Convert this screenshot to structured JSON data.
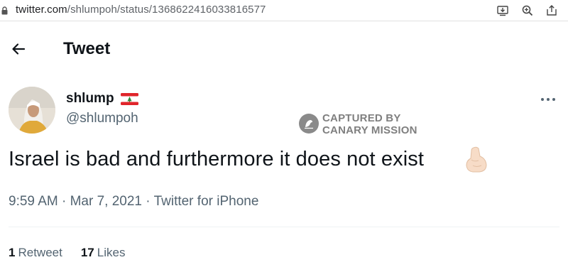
{
  "browser": {
    "url_domain": "twitter.com",
    "url_path": "/shlumpoh/status/1368622416033816577",
    "icons": [
      "lock-icon",
      "install-icon",
      "zoom-icon",
      "share-icon"
    ]
  },
  "header": {
    "title": "Tweet",
    "back_icon": "back-arrow-icon"
  },
  "author": {
    "display_name": "shlump",
    "handle": "@shlumpoh",
    "flag": "lebanon-flag-icon"
  },
  "watermark": {
    "line1": "CAPTURED BY",
    "line2": "CANARY MISSION"
  },
  "tweet": {
    "text": "Israel is bad and furthermore it does not exist",
    "emoji": "pinched-fingers-emoji",
    "time": "9:59 AM",
    "separator": "·",
    "date": "Mar 7, 2021",
    "source": "Twitter for iPhone"
  },
  "stats": {
    "retweets_count": "1",
    "retweets_label": "Retweet",
    "likes_count": "17",
    "likes_label": "Likes"
  },
  "colors": {
    "text_primary": "#0f1419",
    "text_secondary": "#536471",
    "divider": "#eff3f4",
    "watermark": "#7f7f7f"
  }
}
